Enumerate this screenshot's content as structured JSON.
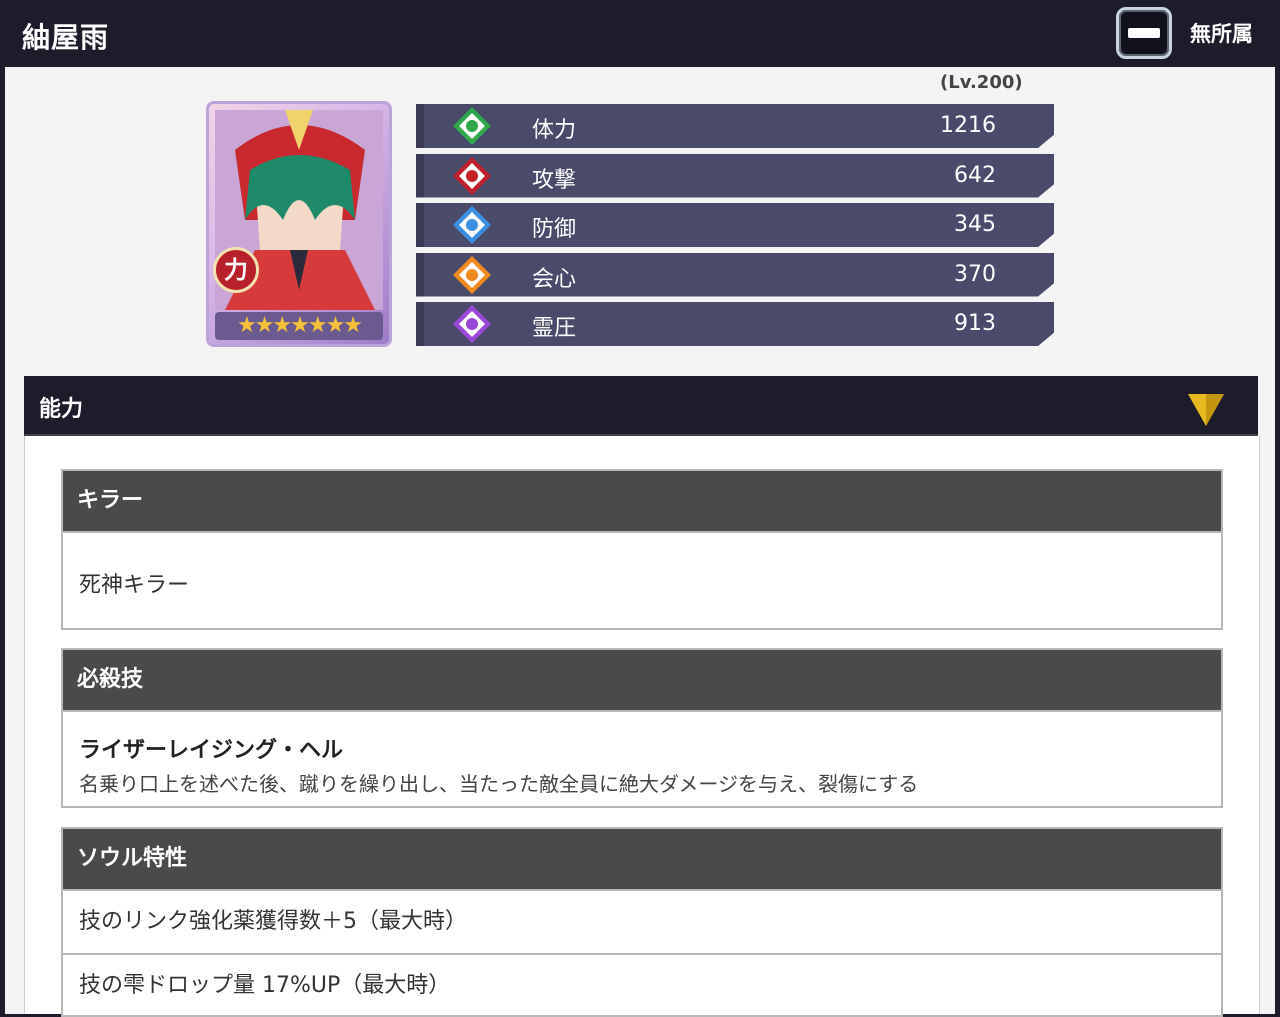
{
  "header": {
    "title": "紬屋雨",
    "affiliation_label": "無所属",
    "affiliation_icon": "minus-badge-icon"
  },
  "profile": {
    "level": "(Lv.200)",
    "badge": "力",
    "stars": "★★★★★★★",
    "star_count": 7
  },
  "stats": [
    {
      "label": "体力",
      "value": "1216",
      "color": "#2ea84a",
      "icon": "hp-drop-icon"
    },
    {
      "label": "攻撃",
      "value": "642",
      "color": "#c0202a",
      "icon": "attack-icon"
    },
    {
      "label": "防御",
      "value": "345",
      "color": "#3a8fe0",
      "icon": "defense-shield-icon"
    },
    {
      "label": "会心",
      "value": "370",
      "color": "#f08a1c",
      "icon": "critical-sun-icon"
    },
    {
      "label": "霊圧",
      "value": "913",
      "color": "#9a46d8",
      "icon": "spirit-swirl-icon"
    }
  ],
  "abilities": {
    "section_label": "能力",
    "killer": {
      "heading": "キラー",
      "text": "死神キラー"
    },
    "special": {
      "heading": "必殺技",
      "name": "ライザーレイジング・ヘル",
      "description": "名乗り口上を述べた後、蹴りを繰り出し、当たった敵全員に絶大ダメージを与え、裂傷にする"
    },
    "soul": {
      "heading": "ソウル特性",
      "lines": [
        "技のリンク強化薬獲得数＋5（最大時）",
        "技の雫ドロップ量 17%UP（最大時）"
      ]
    }
  }
}
